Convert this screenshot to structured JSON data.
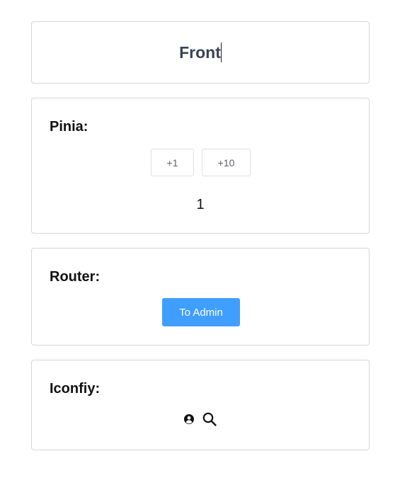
{
  "header": {
    "title": "Front"
  },
  "pinia": {
    "title": "Pinia:",
    "increment_one_label": "+1",
    "increment_ten_label": "+10",
    "count": "1"
  },
  "router": {
    "title": "Router:",
    "to_admin_label": "To Admin"
  },
  "iconify": {
    "title": "Iconfiy:",
    "icons": [
      "user-circle-icon",
      "search-icon"
    ]
  },
  "colors": {
    "primary": "#409eff",
    "title_text": "#384355",
    "border": "#d6d6d9"
  }
}
